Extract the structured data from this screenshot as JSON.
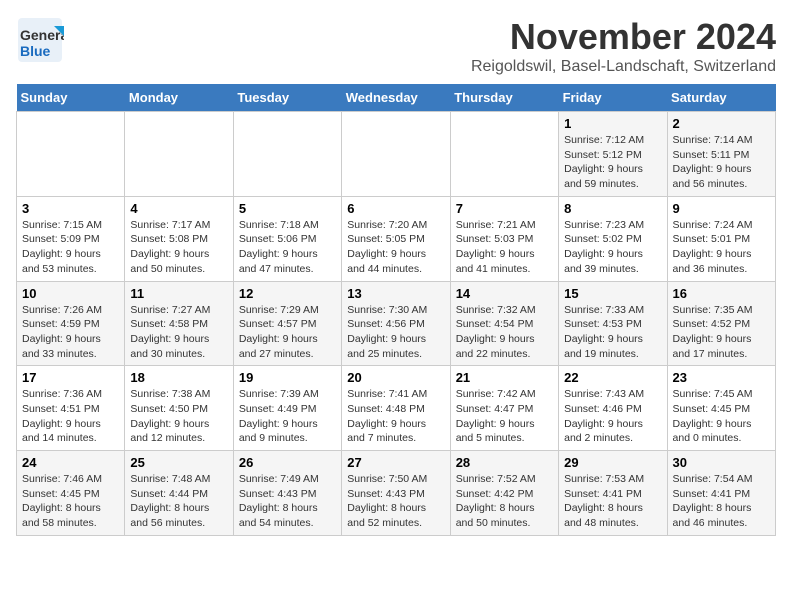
{
  "logo": {
    "line1": "General",
    "line2": "Blue"
  },
  "title": "November 2024",
  "subtitle": "Reigoldswil, Basel-Landschaft, Switzerland",
  "days_of_week": [
    "Sunday",
    "Monday",
    "Tuesday",
    "Wednesday",
    "Thursday",
    "Friday",
    "Saturday"
  ],
  "weeks": [
    [
      {
        "day": "",
        "info": ""
      },
      {
        "day": "",
        "info": ""
      },
      {
        "day": "",
        "info": ""
      },
      {
        "day": "",
        "info": ""
      },
      {
        "day": "",
        "info": ""
      },
      {
        "day": "1",
        "info": "Sunrise: 7:12 AM\nSunset: 5:12 PM\nDaylight: 9 hours and 59 minutes."
      },
      {
        "day": "2",
        "info": "Sunrise: 7:14 AM\nSunset: 5:11 PM\nDaylight: 9 hours and 56 minutes."
      }
    ],
    [
      {
        "day": "3",
        "info": "Sunrise: 7:15 AM\nSunset: 5:09 PM\nDaylight: 9 hours and 53 minutes."
      },
      {
        "day": "4",
        "info": "Sunrise: 7:17 AM\nSunset: 5:08 PM\nDaylight: 9 hours and 50 minutes."
      },
      {
        "day": "5",
        "info": "Sunrise: 7:18 AM\nSunset: 5:06 PM\nDaylight: 9 hours and 47 minutes."
      },
      {
        "day": "6",
        "info": "Sunrise: 7:20 AM\nSunset: 5:05 PM\nDaylight: 9 hours and 44 minutes."
      },
      {
        "day": "7",
        "info": "Sunrise: 7:21 AM\nSunset: 5:03 PM\nDaylight: 9 hours and 41 minutes."
      },
      {
        "day": "8",
        "info": "Sunrise: 7:23 AM\nSunset: 5:02 PM\nDaylight: 9 hours and 39 minutes."
      },
      {
        "day": "9",
        "info": "Sunrise: 7:24 AM\nSunset: 5:01 PM\nDaylight: 9 hours and 36 minutes."
      }
    ],
    [
      {
        "day": "10",
        "info": "Sunrise: 7:26 AM\nSunset: 4:59 PM\nDaylight: 9 hours and 33 minutes."
      },
      {
        "day": "11",
        "info": "Sunrise: 7:27 AM\nSunset: 4:58 PM\nDaylight: 9 hours and 30 minutes."
      },
      {
        "day": "12",
        "info": "Sunrise: 7:29 AM\nSunset: 4:57 PM\nDaylight: 9 hours and 27 minutes."
      },
      {
        "day": "13",
        "info": "Sunrise: 7:30 AM\nSunset: 4:56 PM\nDaylight: 9 hours and 25 minutes."
      },
      {
        "day": "14",
        "info": "Sunrise: 7:32 AM\nSunset: 4:54 PM\nDaylight: 9 hours and 22 minutes."
      },
      {
        "day": "15",
        "info": "Sunrise: 7:33 AM\nSunset: 4:53 PM\nDaylight: 9 hours and 19 minutes."
      },
      {
        "day": "16",
        "info": "Sunrise: 7:35 AM\nSunset: 4:52 PM\nDaylight: 9 hours and 17 minutes."
      }
    ],
    [
      {
        "day": "17",
        "info": "Sunrise: 7:36 AM\nSunset: 4:51 PM\nDaylight: 9 hours and 14 minutes."
      },
      {
        "day": "18",
        "info": "Sunrise: 7:38 AM\nSunset: 4:50 PM\nDaylight: 9 hours and 12 minutes."
      },
      {
        "day": "19",
        "info": "Sunrise: 7:39 AM\nSunset: 4:49 PM\nDaylight: 9 hours and 9 minutes."
      },
      {
        "day": "20",
        "info": "Sunrise: 7:41 AM\nSunset: 4:48 PM\nDaylight: 9 hours and 7 minutes."
      },
      {
        "day": "21",
        "info": "Sunrise: 7:42 AM\nSunset: 4:47 PM\nDaylight: 9 hours and 5 minutes."
      },
      {
        "day": "22",
        "info": "Sunrise: 7:43 AM\nSunset: 4:46 PM\nDaylight: 9 hours and 2 minutes."
      },
      {
        "day": "23",
        "info": "Sunrise: 7:45 AM\nSunset: 4:45 PM\nDaylight: 9 hours and 0 minutes."
      }
    ],
    [
      {
        "day": "24",
        "info": "Sunrise: 7:46 AM\nSunset: 4:45 PM\nDaylight: 8 hours and 58 minutes."
      },
      {
        "day": "25",
        "info": "Sunrise: 7:48 AM\nSunset: 4:44 PM\nDaylight: 8 hours and 56 minutes."
      },
      {
        "day": "26",
        "info": "Sunrise: 7:49 AM\nSunset: 4:43 PM\nDaylight: 8 hours and 54 minutes."
      },
      {
        "day": "27",
        "info": "Sunrise: 7:50 AM\nSunset: 4:43 PM\nDaylight: 8 hours and 52 minutes."
      },
      {
        "day": "28",
        "info": "Sunrise: 7:52 AM\nSunset: 4:42 PM\nDaylight: 8 hours and 50 minutes."
      },
      {
        "day": "29",
        "info": "Sunrise: 7:53 AM\nSunset: 4:41 PM\nDaylight: 8 hours and 48 minutes."
      },
      {
        "day": "30",
        "info": "Sunrise: 7:54 AM\nSunset: 4:41 PM\nDaylight: 8 hours and 46 minutes."
      }
    ]
  ]
}
